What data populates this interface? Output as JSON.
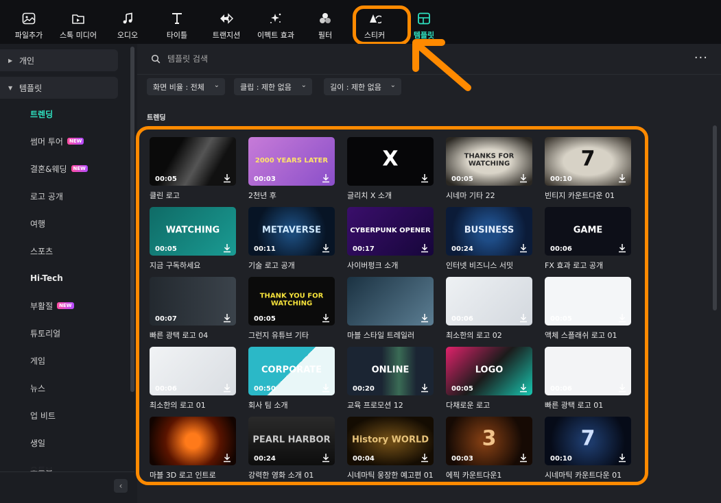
{
  "toolbar": {
    "items": [
      {
        "label": "파일추가",
        "icon": "import-media-icon"
      },
      {
        "label": "스톡 미디어",
        "icon": "stock-media-icon"
      },
      {
        "label": "오디오",
        "icon": "audio-note-icon"
      },
      {
        "label": "타이틀",
        "icon": "text-t-icon"
      },
      {
        "label": "트랜지션",
        "icon": "transition-arrows-icon"
      },
      {
        "label": "이펙트 효과",
        "icon": "effects-sparkle-icon"
      },
      {
        "label": "필터",
        "icon": "filter-circles-icon"
      },
      {
        "label": "스티커",
        "icon": "sticker-icon"
      },
      {
        "label": "템플릿",
        "icon": "template-grid-icon"
      }
    ],
    "active_index": 8
  },
  "sidebar": {
    "sections": [
      {
        "label": "개인",
        "expanded": false
      },
      {
        "label": "템플릿",
        "expanded": true
      }
    ],
    "items": [
      {
        "label": "트렌딩",
        "active": true,
        "badge": ""
      },
      {
        "label": "썸머 투어",
        "badge": "NEW"
      },
      {
        "label": "결혼&웨딩",
        "badge": "NEW"
      },
      {
        "label": "로고 공개",
        "badge": ""
      },
      {
        "label": "여행",
        "badge": ""
      },
      {
        "label": "스포츠",
        "badge": ""
      },
      {
        "label": "Hi-Tech",
        "badge": ""
      },
      {
        "label": "부활절",
        "badge": "NEW"
      },
      {
        "label": "튜토리얼",
        "badge": ""
      },
      {
        "label": "게임",
        "badge": ""
      },
      {
        "label": "뉴스",
        "badge": ""
      },
      {
        "label": "업 비트",
        "badge": ""
      },
      {
        "label": "생일",
        "badge": ""
      },
      {
        "label": "유튜브",
        "badge": ""
      }
    ]
  },
  "search": {
    "placeholder": "템플릿 검색"
  },
  "filters": [
    {
      "label": "화면 비율 : 전체"
    },
    {
      "label": "클립 : 제한 없음"
    },
    {
      "label": "길이 : 제한 없음"
    }
  ],
  "section_title": "트렌딩",
  "templates": [
    {
      "title": "클린 로고",
      "duration": "00:05",
      "bg": "linear-gradient(120deg,#0a0a0a 30%,#555 55%,#111 75%)",
      "text": "",
      "text_color": "#fff"
    },
    {
      "title": "2천년 후",
      "duration": "00:03",
      "bg": "linear-gradient(135deg,#c77bd8,#8a4fc9)",
      "text": "2000 YEARS LATER",
      "text_color": "#ffe36b"
    },
    {
      "title": "글리치 X 소개",
      "duration": "",
      "bg": "#060608",
      "text": "X",
      "text_color": "#ffffff"
    },
    {
      "title": "시네마 기타 22",
      "duration": "00:05",
      "bg": "radial-gradient(ellipse at center,#d9d4c8 35%,#2a2722 90%)",
      "text": "THANKS FOR WATCHING",
      "text_color": "#2a2a2a"
    },
    {
      "title": "빈티지 카운트다운 01",
      "duration": "00:10",
      "bg": "radial-gradient(ellipse at center,#d7d2c6 40%,#3a352e 95%)",
      "text": "7",
      "text_color": "#111"
    },
    {
      "title": "지금 구독하세요",
      "duration": "00:05",
      "bg": "linear-gradient(135deg,#0f6b66,#1a9b93)",
      "text": "WATCHING",
      "text_color": "#ffffff"
    },
    {
      "title": "기술 로고 공개",
      "duration": "00:11",
      "bg": "radial-gradient(circle at center,#1b4a7a 10%,#071425 70%)",
      "text": "METAVERSE",
      "text_color": "#cfe9ff"
    },
    {
      "title": "사이버펑크 소개",
      "duration": "00:17",
      "bg": "linear-gradient(135deg,#3a0e6b,#16063a)",
      "text": "CYBERPUNK OPENER",
      "text_color": "#ffffff"
    },
    {
      "title": "인터넷 비즈니스 서밋",
      "duration": "00:24",
      "bg": "radial-gradient(circle at center,#1e4c86 20%,#0b1b38 75%)",
      "text": "BUSINESS",
      "text_color": "#e6f0ff"
    },
    {
      "title": "FX 효과 로고 공개",
      "duration": "00:06",
      "bg": "#0d0f18",
      "text": "GAME",
      "text_color": "#ffffff"
    },
    {
      "title": "빠른 광택 로고 04",
      "duration": "00:07",
      "bg": "linear-gradient(90deg,#23292f,#3b434b)",
      "text": "",
      "text_color": "#fff"
    },
    {
      "title": "그런지 유튜브 기타",
      "duration": "00:05",
      "bg": "#0b0b0b",
      "text": "THANK YOU FOR WATCHING",
      "text_color": "#f5e23b"
    },
    {
      "title": "마블 스타일 트레일러",
      "duration": "",
      "bg": "linear-gradient(135deg,#1b3242,#5c7e93)",
      "text": "",
      "text_color": "#fff"
    },
    {
      "title": "최소한의 로고 02",
      "duration": "00:06",
      "bg": "linear-gradient(135deg,#eef1f4,#d3d8de)",
      "text": "",
      "text_color": "#333"
    },
    {
      "title": "액체 스플래쉬 로고 01",
      "duration": "00:05",
      "bg": "#f4f6f8",
      "text": "",
      "text_color": "#333"
    },
    {
      "title": "최소한의 로고 01",
      "duration": "00:06",
      "bg": "linear-gradient(135deg,#f1f3f5,#d9dde2)",
      "text": "",
      "text_color": "#333"
    },
    {
      "title": "회사 팀 소개",
      "duration": "00:50",
      "bg": "linear-gradient(135deg,#2bb8c7 50%,#e9f7f8 50%)",
      "text": "CORPORATE",
      "text_color": "#ffffff"
    },
    {
      "title": "교육 프로모션 12",
      "duration": "00:20",
      "bg": "linear-gradient(90deg,#1b2533 40%,#3a6b55 60%,#1b2533 80%)",
      "text": "ONLINE",
      "text_color": "#ffffff"
    },
    {
      "title": "다채로운 로고",
      "duration": "00:05",
      "bg": "linear-gradient(135deg,#e0226b,#1b1b1b 50%,#18c6b0)",
      "text": "LOGO",
      "text_color": "#ffffff"
    },
    {
      "title": "빠른 광택 로고 01",
      "duration": "00:06",
      "bg": "#f3f4f6",
      "text": "",
      "text_color": "#333"
    },
    {
      "title": "마블 3D 로고 인트로",
      "duration": "",
      "bg": "radial-gradient(circle at center,#ff7a1a 15%,#5a1400 55%,#120400 90%)",
      "text": "",
      "text_color": "#fff"
    },
    {
      "title": "강력한 영화 소개 01",
      "duration": "00:24",
      "bg": "linear-gradient(#2a2a2a,#0d0d0d)",
      "text": "PEARL HARBOR",
      "text_color": "#c9c9c9"
    },
    {
      "title": "시네마틱 웅장한 예고편 01",
      "duration": "00:04",
      "bg": "radial-gradient(ellipse at center,#6b4a15 10%,#140c02 75%)",
      "text": "History WORLD",
      "text_color": "#e6c27a"
    },
    {
      "title": "에픽 카운트다운1",
      "duration": "00:03",
      "bg": "radial-gradient(circle at 45% 50%,#7a3a12 10%,#160a04 70%)",
      "text": "3",
      "text_color": "#f0c28a"
    },
    {
      "title": "시네마틱 카운트다운 01",
      "duration": "00:10",
      "bg": "radial-gradient(circle at center,#1d3a6a 10%,#060b18 75%)",
      "text": "7",
      "text_color": "#cfe0ff"
    }
  ],
  "colors": {
    "accent": "#2fe3c2",
    "highlight": "#ff8a00"
  }
}
